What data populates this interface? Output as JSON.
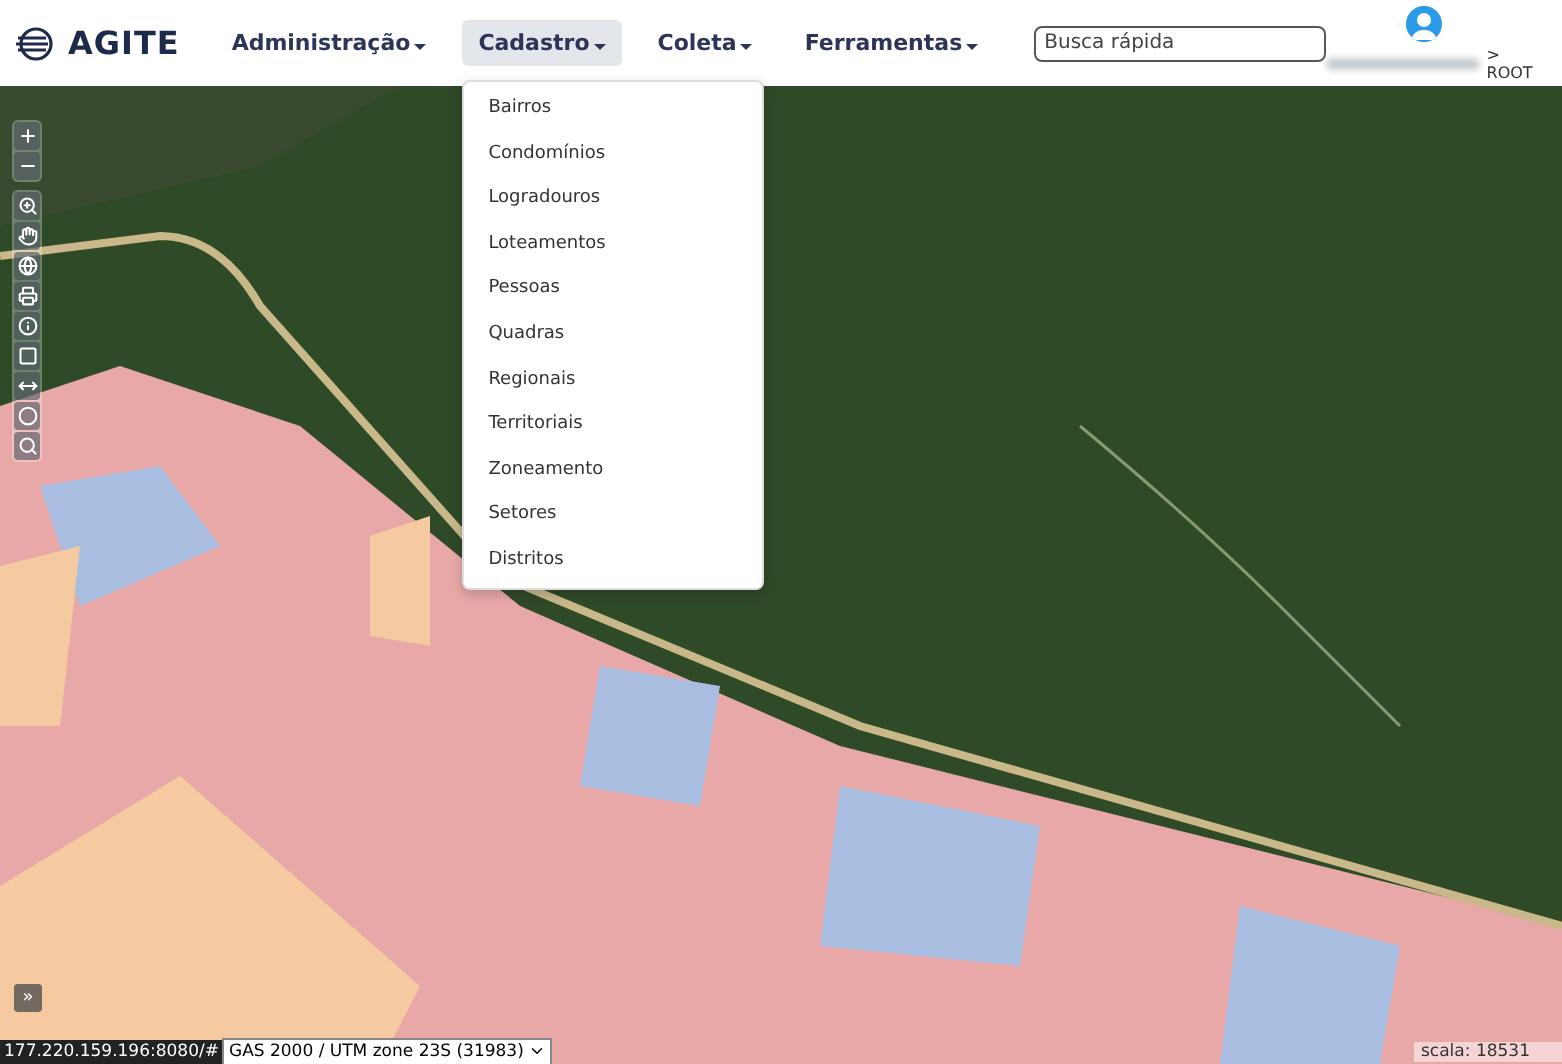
{
  "header": {
    "logo": "AGITE",
    "nav": [
      {
        "label": "Administração",
        "selected": false
      },
      {
        "label": "Cadastro",
        "selected": true,
        "menu": [
          "Bairros",
          "Condomínios",
          "Logradouros",
          "Loteamentos",
          "Pessoas",
          "Quadras",
          "Regionais",
          "Territoriais",
          "Zoneamento",
          "Setores",
          "Distritos"
        ]
      },
      {
        "label": "Coleta",
        "selected": false
      },
      {
        "label": "Ferramentas",
        "selected": false
      }
    ],
    "search": {
      "placeholder": "Busca rápida"
    },
    "user": {
      "role": "> ROOT"
    }
  },
  "map": {
    "expand_button": "»",
    "status_url": "177.220.159.196:8080/#",
    "projection": "GAS 2000 / UTM zone 23S (31983)",
    "scale": "scala: 18531"
  }
}
